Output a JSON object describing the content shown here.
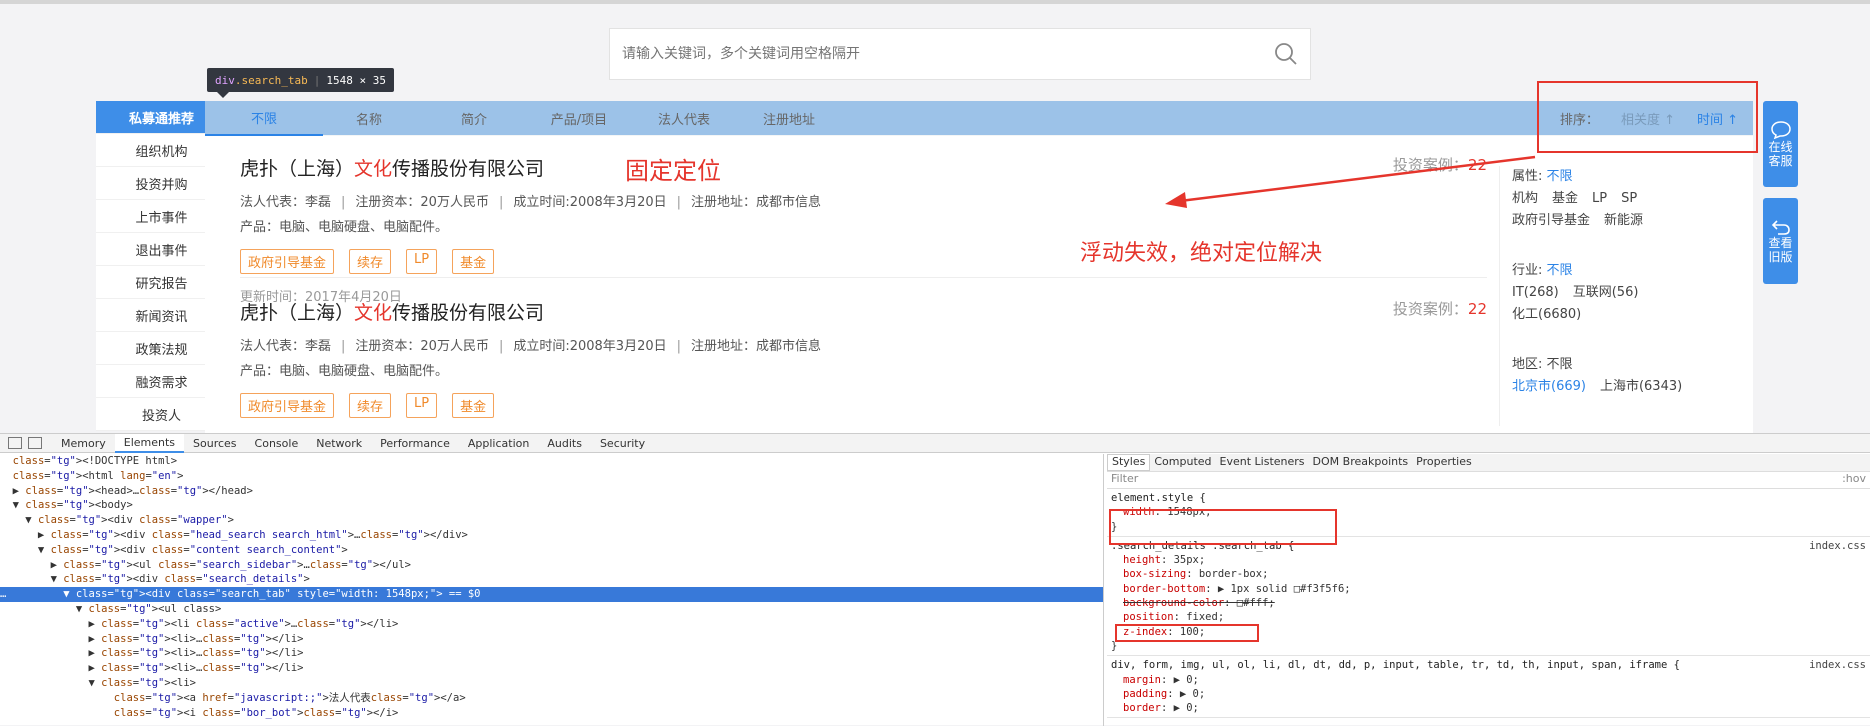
{
  "search": {
    "placeholder": "请输入关键词，多个关键词用空格隔开"
  },
  "tooltip": {
    "tag": "div",
    "cls": ".search_tab",
    "size": "1548 × 35"
  },
  "sidebar": {
    "items": [
      "私募通推荐",
      "组织机构",
      "投资并购",
      "上市事件",
      "退出事件",
      "研究报告",
      "新闻资讯",
      "政策法规",
      "融资需求",
      "投资人"
    ]
  },
  "tabs": [
    "不限",
    "名称",
    "简介",
    "产品/项目",
    "法人代表",
    "注册地址"
  ],
  "sort": {
    "label": "排序：",
    "relevance": "相关度 ↑",
    "time": "时间 ↑"
  },
  "cards": [
    {
      "name_prefix": "虎扑（上海）",
      "name_hl": "文化",
      "name_suffix": "传播股份有限公司",
      "rep": "法人代表：李磊",
      "capital": "注册资本：20万人民币",
      "established": "成立时间:2008年3月20日",
      "address": "注册地址：成都市信息",
      "products": "产品：电脑、电脑硬盘、电脑配件。",
      "tags": [
        "政府引导基金",
        "续存",
        "LP",
        "基金"
      ],
      "updated": "更新时间：2017年4月20日",
      "cases_label": "投资案例：",
      "cases_num": "22"
    },
    {
      "name_prefix": "虎扑（上海）",
      "name_hl": "文化",
      "name_suffix": "传播股份有限公司",
      "rep": "法人代表：李磊",
      "capital": "注册资本：20万人民币",
      "established": "成立时间:2008年3月20日",
      "address": "注册地址：成都市信息",
      "products": "产品：电脑、电脑硬盘、电脑配件。",
      "tags": [
        "政府引导基金",
        "续存",
        "LP",
        "基金"
      ],
      "cases_label": "投资案例：",
      "cases_num": "22"
    }
  ],
  "filter": {
    "attr_label": "属性: ",
    "attr_value": "不限",
    "attr_items": [
      "机构",
      "基金",
      "LP",
      "SP"
    ],
    "attr_items2": [
      "政府引导基金",
      "新能源"
    ],
    "industry_label": "行业: ",
    "industry_value": "不限",
    "industry_items": [
      "IT(268)",
      "互联网(56)"
    ],
    "industry_items2": [
      "化工(6680)"
    ],
    "region_label": "地区: 不限",
    "region_items": [
      "北京市(669)",
      "上海市(6343)"
    ]
  },
  "annotations": {
    "fixed": "固定定位",
    "float": "浮动失效，绝对定位解决"
  },
  "float_buttons": {
    "online": "在线\n客服",
    "old": "查看\n旧版"
  },
  "devtools": {
    "tabs": [
      "Memory",
      "Elements",
      "Sources",
      "Console",
      "Network",
      "Performance",
      "Application",
      "Audits",
      "Security"
    ],
    "style_tabs": [
      "Styles",
      "Computed",
      "Event Listeners",
      "DOM Breakpoints",
      "Properties"
    ],
    "filter_label": "Filter",
    "hov": ":hov",
    "dom_lines": [
      "<!DOCTYPE html>",
      "<html lang=\"en\">",
      "▶ <head>…</head>",
      "▼ <body>",
      "  ▼ <div class=\"wapper\">",
      "    ▶ <div class=\"head_search search_html\">…</div>",
      "    ▼ <div class=\"content search_content\">",
      "      ▶ <ul class=\"search_sidebar\">…</ul>",
      "      ▼ <div class=\"search_details\">",
      "        ▼ <div class=\"search_tab\" style=\"width: 1548px;\"> == $0",
      "          ▼ <ul class>",
      "            ▶ <li class=\"active\">…</li>",
      "            ▶ <li>…</li>",
      "            ▶ <li>…</li>",
      "            ▶ <li>…</li>",
      "            ▼ <li>",
      "                <a href=\"javascript:;\">法人代表</a>",
      "                <i class=\"bor_bot\"></i>"
    ],
    "rules": {
      "element_style": {
        "selector": "element.style {",
        "props": [
          "width: 1548px;"
        ]
      },
      "search_tab": {
        "selector": ".search_details .search_tab {",
        "source": "index.css",
        "props": [
          "height: 35px;",
          "box-sizing: border-box;",
          "border-bottom: ▶ 1px solid □#f3f5f6;",
          "background-color: □#fff;",
          "position: fixed;",
          "z-index: 100;"
        ]
      },
      "reset": {
        "selector": "div, form, img, ul, ol, li, dl, dt, dd, p, input, table, tr, td, th, input, span, iframe {",
        "source": "index.css",
        "props": [
          "margin: ▶ 0;",
          "padding: ▶ 0;",
          "border: ▶ 0;"
        ]
      }
    }
  }
}
